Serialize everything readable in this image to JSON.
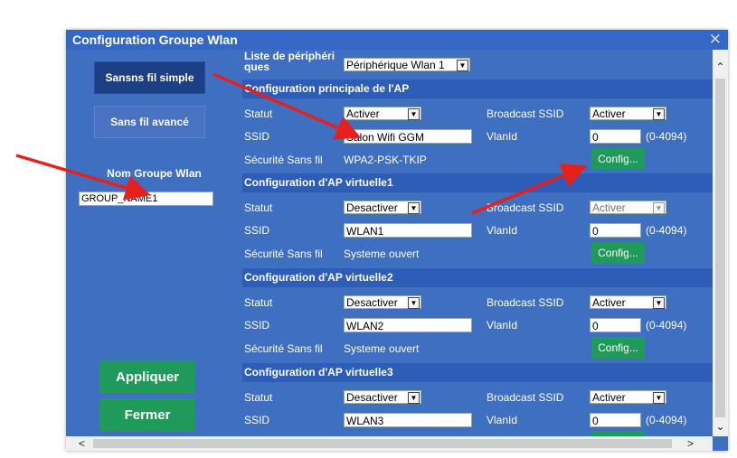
{
  "dialog": {
    "title": "Configuration Groupe Wlan"
  },
  "left": {
    "nav_simple": "Sansns fil simple",
    "nav_advanced": "Sans fil avancé",
    "group_label": "Nom Groupe Wlan",
    "group_value": "GROUP_NAME1",
    "apply": "Appliquer",
    "close": "Fermer"
  },
  "device": {
    "label": "Liste de périphéri ques",
    "value": "Périphérique Wlan 1"
  },
  "labels": {
    "statut": "Statut",
    "ssid": "SSID",
    "securite": "Sécurité Sans fil",
    "broadcast": "Broadcast SSID",
    "vlanid": "VlanId",
    "range": "(0-4094)",
    "config": "Config..."
  },
  "sections": [
    {
      "title": "Configuration principale de l'AP",
      "statut": "Activer",
      "ssid": "Salon Wifi GGM",
      "broadcast": "Activer",
      "vlanid": "0",
      "securite": "WPA2-PSK-TKIP"
    },
    {
      "title": "Configuration d'AP virtuelle1",
      "statut": "Desactiver",
      "ssid": "WLAN1",
      "broadcast": "Activer",
      "vlanid": "0",
      "securite": "Systeme ouvert"
    },
    {
      "title": "Configuration d'AP virtuelle2",
      "statut": "Desactiver",
      "ssid": "WLAN2",
      "broadcast": "Activer",
      "vlanid": "0",
      "securite": "Systeme ouvert"
    },
    {
      "title": "Configuration d'AP virtuelle3",
      "statut": "Desactiver",
      "ssid": "WLAN3",
      "broadcast": "Activer",
      "vlanid": "0"
    }
  ],
  "icons": {
    "close": "close-icon",
    "dropdown": "chevron-down-icon",
    "annotation": "arrow-icon"
  },
  "colors": {
    "dialog_bg": "#3f6fc0",
    "nav_active": "#1d3f86",
    "action_green": "#1f9a5a",
    "annotation": "#e8201c"
  }
}
